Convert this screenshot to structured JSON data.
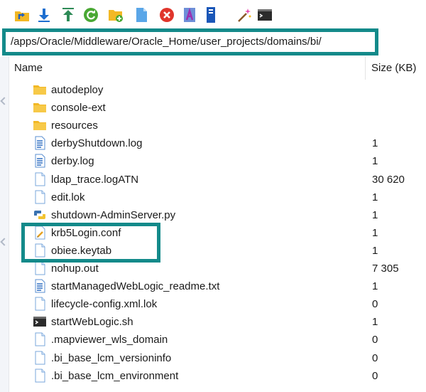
{
  "toolbar": {
    "buttons": [
      {
        "name": "parent-directory-icon"
      },
      {
        "name": "download-icon"
      },
      {
        "name": "upload-icon"
      },
      {
        "name": "refresh-icon"
      },
      {
        "name": "new-folder-icon"
      },
      {
        "name": "new-file-icon"
      },
      {
        "name": "delete-icon"
      },
      {
        "name": "rename-icon"
      },
      {
        "name": "properties-icon"
      },
      {
        "name": "magic-wand-icon"
      },
      {
        "name": "terminal-icon"
      }
    ]
  },
  "path": {
    "value": "/apps/Oracle/Middleware/Oracle_Home/user_projects/domains/bi/"
  },
  "columns": {
    "name": "Name",
    "size": "Size (KB)"
  },
  "files": [
    {
      "name": "autodeploy",
      "size": "",
      "type": "folder"
    },
    {
      "name": "console-ext",
      "size": "",
      "type": "folder"
    },
    {
      "name": "resources",
      "size": "",
      "type": "folder"
    },
    {
      "name": "derbyShutdown.log",
      "size": "1",
      "type": "text"
    },
    {
      "name": "derby.log",
      "size": "1",
      "type": "text"
    },
    {
      "name": "ldap_trace.logATN",
      "size": "30 620",
      "type": "file"
    },
    {
      "name": "edit.lok",
      "size": "1",
      "type": "file"
    },
    {
      "name": "shutdown-AdminServer.py",
      "size": "1",
      "type": "python"
    },
    {
      "name": "krb5Login.conf",
      "size": "1",
      "type": "conf"
    },
    {
      "name": "obiee.keytab",
      "size": "1",
      "type": "file"
    },
    {
      "name": "nohup.out",
      "size": "7 305",
      "type": "file"
    },
    {
      "name": "startManagedWebLogic_readme.txt",
      "size": "1",
      "type": "text"
    },
    {
      "name": "lifecycle-config.xml.lok",
      "size": "0",
      "type": "file"
    },
    {
      "name": "startWebLogic.sh",
      "size": "1",
      "type": "shell"
    },
    {
      "name": ".mapviewer_wls_domain",
      "size": "0",
      "type": "file"
    },
    {
      "name": ".bi_base_lcm_versioninfo",
      "size": "0",
      "type": "file"
    },
    {
      "name": ".bi_base_lcm_environment",
      "size": "0",
      "type": "file"
    }
  ],
  "colors": {
    "highlight": "#138a8a",
    "folder": "#f2b825",
    "doc_line": "#2f6fc2"
  }
}
